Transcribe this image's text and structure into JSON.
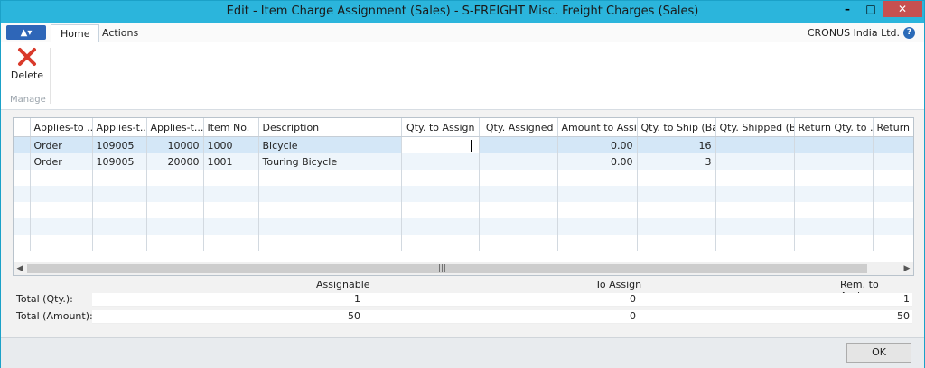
{
  "window": {
    "title": "Edit - Item Charge Assignment (Sales) - S-FREIGHT Misc. Freight Charges (Sales)"
  },
  "ribbon": {
    "tabs": [
      "Home",
      "Actions"
    ],
    "company": "CRONUS India Ltd.",
    "delete_label": "Delete",
    "group_label": "Manage"
  },
  "table": {
    "columns": [
      "Applies-to ...",
      "Applies-t...",
      "Applies-t...",
      "Item No.",
      "Description",
      "Qty. to Assign",
      "Qty. Assigned",
      "Amount to Assi...",
      "Qty. to Ship (Ba...",
      "Qty. Shipped (B...",
      "Return Qty. to ...",
      "Return Q"
    ],
    "rows": [
      [
        "Order",
        "109005",
        "10000",
        "1000",
        "Bicycle",
        "",
        "",
        "0.00",
        "16",
        "",
        "",
        ""
      ],
      [
        "Order",
        "109005",
        "20000",
        "1001",
        "Touring Bicycle",
        "",
        "",
        "0.00",
        "3",
        "",
        "",
        ""
      ]
    ]
  },
  "totals": {
    "headers": {
      "assignable": "Assignable",
      "to_assign": "To Assign",
      "rem_to_assign": "Rem. to Assign"
    },
    "qty": {
      "label": "Total (Qty.):",
      "assignable": "1",
      "to_assign": "0",
      "rem": "1"
    },
    "amount": {
      "label": "Total (Amount):",
      "assignable": "50",
      "to_assign": "0",
      "rem": "50"
    }
  },
  "footer": {
    "ok_label": "OK"
  }
}
